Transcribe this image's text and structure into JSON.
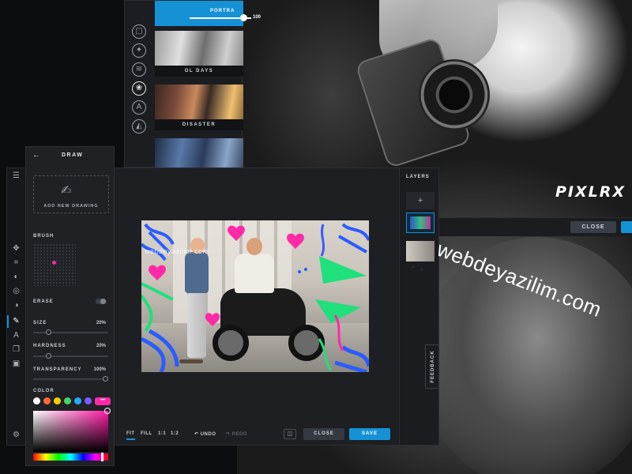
{
  "background": {
    "logo_text": "PIXLRX",
    "close_label": "CLOSE"
  },
  "filter_panel": {
    "slider": {
      "label": "PORTRA",
      "value": "100"
    },
    "filters": [
      {
        "name": "OL DAYS"
      },
      {
        "name": "DISASTER"
      }
    ]
  },
  "draw_panel": {
    "title": "DRAW",
    "add_drawing_label": "ADD NEW DRAWING",
    "brush_label": "BRUSH",
    "erase_label": "ERASE",
    "size": {
      "label": "SIZE",
      "value": "20%",
      "fraction": 0.2
    },
    "hardness": {
      "label": "HARDNESS",
      "value": "20%",
      "fraction": 0.2
    },
    "transparency": {
      "label": "TRANSPARENCY",
      "value": "100%",
      "fraction": 1.0
    },
    "color_label": "COLOR",
    "selected_color_label": "•••",
    "swatches": [
      "#ffffff",
      "#ff6a3a",
      "#f5d000",
      "#44d46a",
      "#2aa6ff",
      "#7a5cff"
    ],
    "selected_color": "#ff2aa7"
  },
  "canvas": {
    "watermark_small": "webdeyazilim.com"
  },
  "bottom_bar": {
    "fit": "FIT",
    "fill": "FILL",
    "one_to_one": "1:1",
    "one_to_two": "1:2",
    "undo": "↶ UNDO",
    "redo": "↷ REDO",
    "close": "CLOSE",
    "save": "SAVE"
  },
  "layers": {
    "title": "LAYERS",
    "add": "+"
  },
  "feedback": "FEEDBACK",
  "watermark": "webdeyazilim.com",
  "colors": {
    "accent": "#1592d6",
    "panel": "#1d1f23",
    "brush": "#ff2aa7"
  }
}
